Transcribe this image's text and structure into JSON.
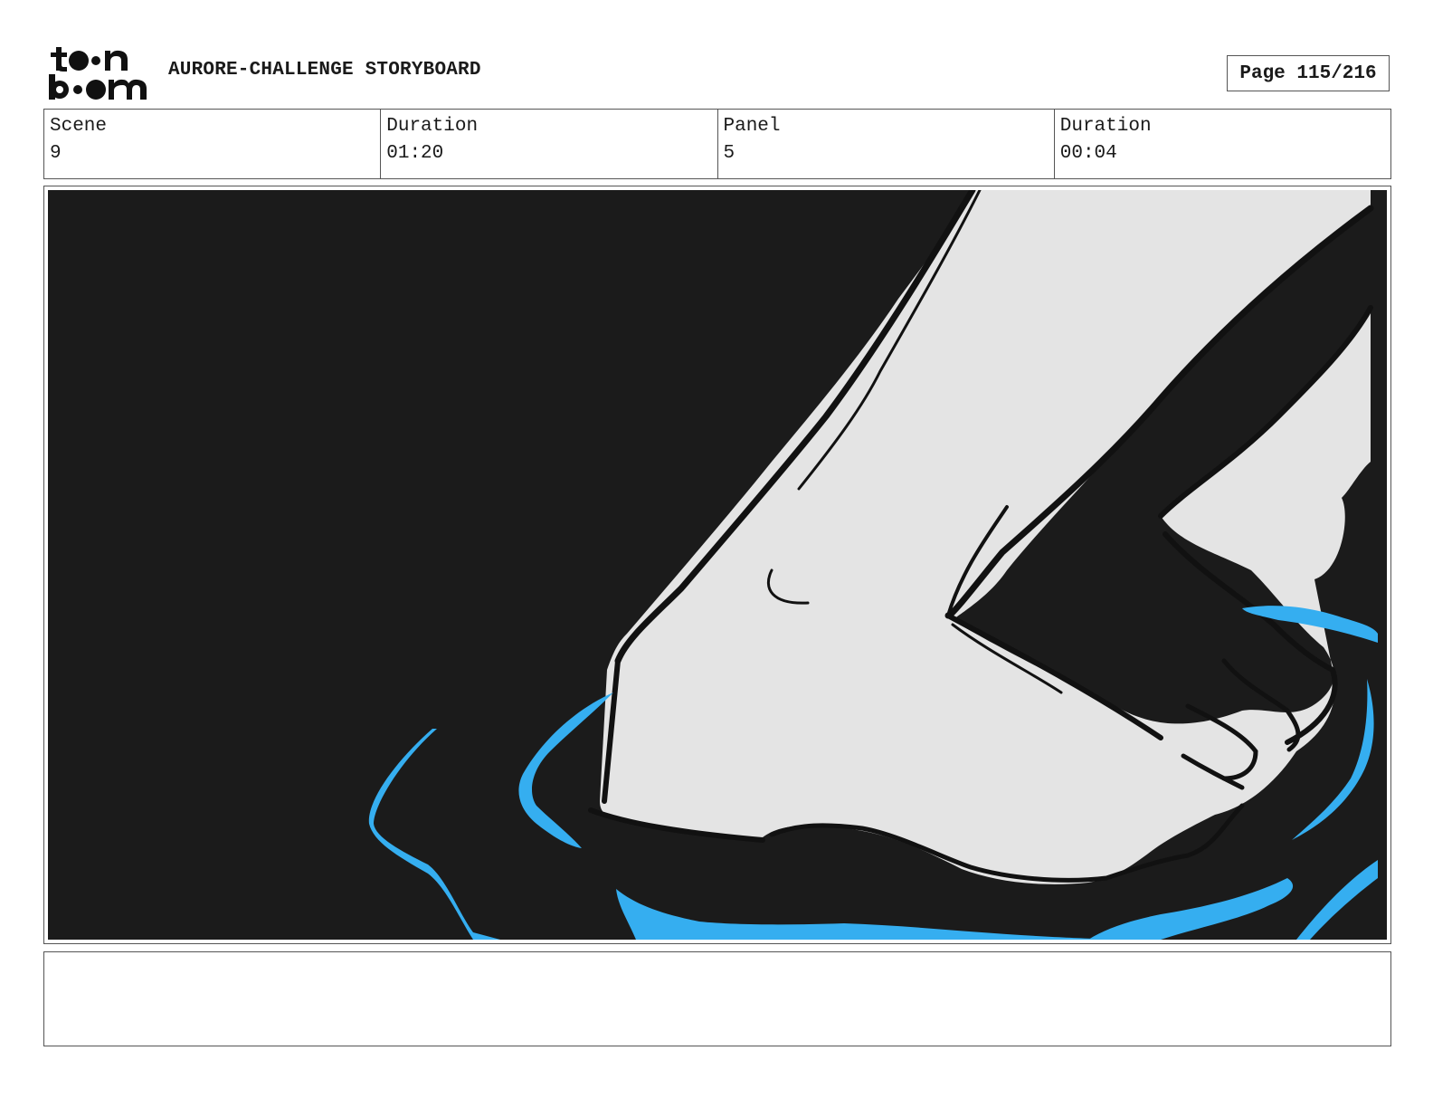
{
  "header": {
    "logo_text": "toon boom",
    "project_title": "AURORE-CHALLENGE STORYBOARD",
    "page_label": "Page 115/216"
  },
  "info": [
    {
      "label": "Scene",
      "value": "9"
    },
    {
      "label": "Duration",
      "value": "01:20"
    },
    {
      "label": "Panel",
      "value": "5"
    },
    {
      "label": "Duration",
      "value": "00:04"
    }
  ],
  "panel": {
    "background_color": "#1b1b1b",
    "figure_color": "#e4e4e4",
    "accent_color": "#35aef0"
  },
  "caption": {
    "text": ""
  }
}
